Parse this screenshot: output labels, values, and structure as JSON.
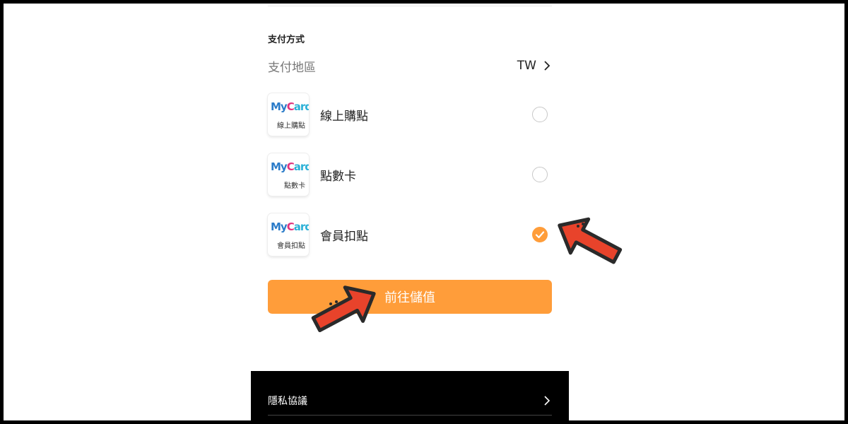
{
  "payment": {
    "section_title": "支付方式",
    "region_label": "支付地區",
    "region_value": "TW",
    "methods": [
      {
        "label": "線上購點",
        "logo_text": "線上購點",
        "selected": false
      },
      {
        "label": "點數卡",
        "logo_text": "點數卡",
        "selected": false
      },
      {
        "label": "會員扣點",
        "logo_text": "會員扣點",
        "selected": true
      }
    ],
    "logo_brand": {
      "my": "My",
      "c": "C",
      "ard": "ard"
    },
    "submit_label": "前往儲值"
  },
  "footer": {
    "items": [
      {
        "label": "隱私協議"
      }
    ]
  },
  "colors": {
    "accent": "#ff9d3a",
    "annotation_arrow": "#e8432b",
    "footer_bg": "#000000"
  },
  "icons": {
    "region_chevron": "chevron-right-icon",
    "selected_radio": "check-icon",
    "annotation": "arrow-pointer-icon"
  }
}
